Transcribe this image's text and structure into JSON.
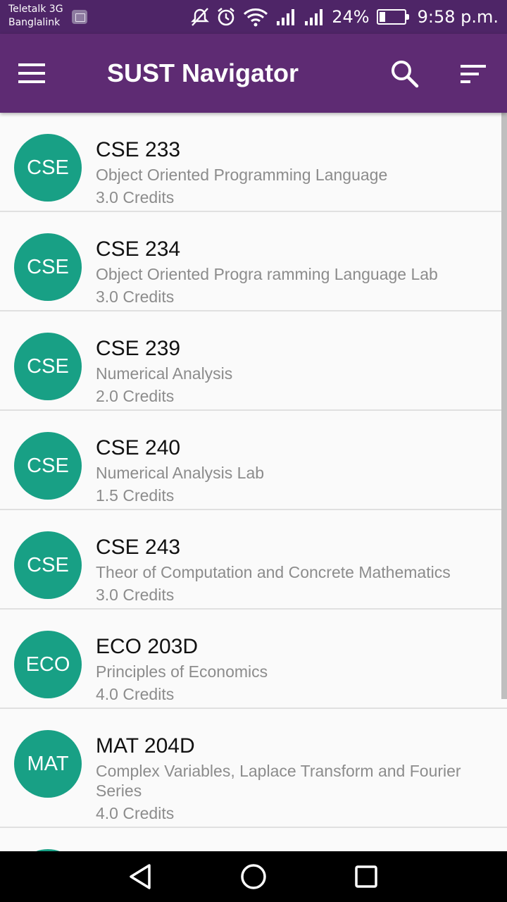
{
  "status_bar": {
    "carrier_line1": "Teletalk 3G",
    "carrier_line2": "Banglalink",
    "battery_percent": "24%",
    "battery_level": 0.24,
    "time": "9:58 p.m."
  },
  "app_bar": {
    "title": "SUST Navigator",
    "menu_icon": "hamburger-icon",
    "search_icon": "search-icon",
    "sort_icon": "sort-icon"
  },
  "courses": [
    {
      "dept": "CSE",
      "code": "CSE 233",
      "name": "Object Oriented Programming Language",
      "credits": "3.0 Credits"
    },
    {
      "dept": "CSE",
      "code": "CSE 234",
      "name": "Object Oriented Progra ramming Language Lab",
      "credits": "3.0 Credits"
    },
    {
      "dept": "CSE",
      "code": "CSE 239",
      "name": "Numerical Analysis",
      "credits": "2.0 Credits"
    },
    {
      "dept": "CSE",
      "code": "CSE 240",
      "name": "Numerical Analysis Lab",
      "credits": "1.5 Credits"
    },
    {
      "dept": "CSE",
      "code": "CSE 243",
      "name": "Theor of Computation and Concrete Mathematics",
      "credits": "3.0 Credits"
    },
    {
      "dept": "ECO",
      "code": "ECO 203D",
      "name": "Principles of Economics",
      "credits": "4.0 Credits"
    },
    {
      "dept": "MAT",
      "code": "MAT 204D",
      "name": "Complex Variables, Laplace Transform and Fourier Series",
      "credits": "4.0 Credits"
    }
  ],
  "colors": {
    "status_bar": "#4e2567",
    "app_bar": "#5e2b73",
    "avatar": "#18a085",
    "background": "#fafafa"
  }
}
